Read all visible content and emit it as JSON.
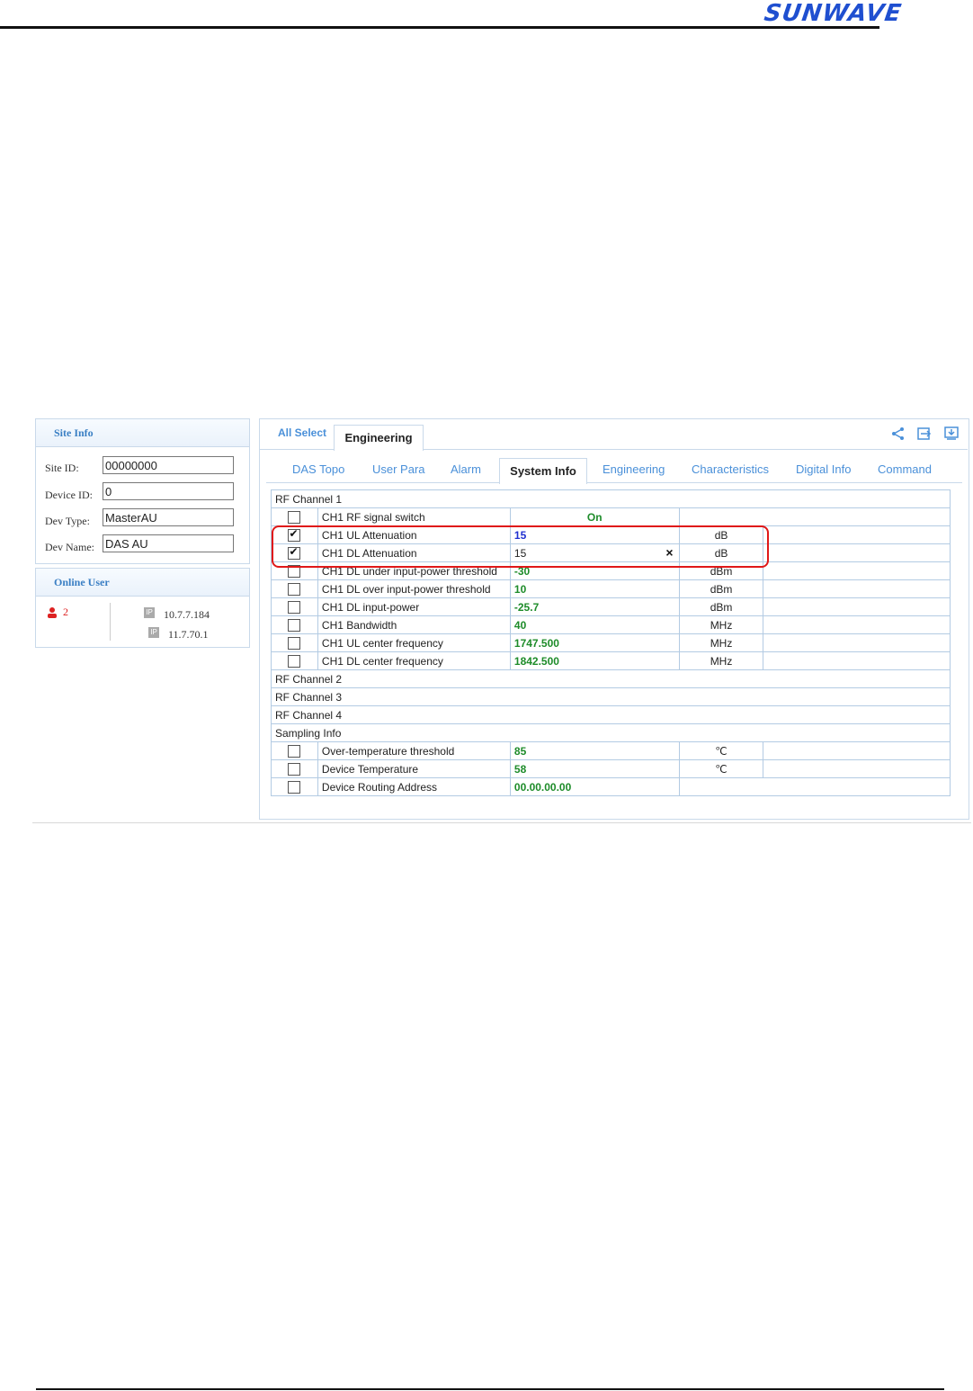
{
  "brand": {
    "logo_text": "SUNWAVE"
  },
  "site_info": {
    "title": "Site Info",
    "fields": [
      {
        "label": "Site ID:",
        "value": "00000000"
      },
      {
        "label": "Device ID:",
        "value": "0"
      },
      {
        "label": "Dev Type:",
        "value": "MasterAU"
      },
      {
        "label": "Dev Name:",
        "value": "DAS AU"
      }
    ]
  },
  "online_user": {
    "title": "Online User",
    "count": "2",
    "ips": [
      "10.7.7.184",
      "11.7.70.1"
    ],
    "ip_badge": "IP"
  },
  "top_tabs": [
    "All Select",
    "Engineering"
  ],
  "toolbar": {
    "share_icon": "share-icon",
    "export_icon": "export-icon",
    "download_icon": "download-icon"
  },
  "sub_tabs": [
    "DAS Topo",
    "User Para",
    "Alarm",
    "System Info",
    "Engineering",
    "Characteristics",
    "Digital Info",
    "Command"
  ],
  "active_sub_tab": "System Info",
  "groups": {
    "rf1": "RF Channel 1",
    "rf2": "RF Channel 2",
    "rf3": "RF Channel 3",
    "rf4": "RF Channel 4",
    "sampling": "Sampling Info"
  },
  "rf1_rows": [
    {
      "name": "CH1 RF signal switch",
      "value": "On",
      "unit": "",
      "checked": false
    },
    {
      "name": "CH1 UL Attenuation",
      "value": "15",
      "unit": "dB",
      "checked": true
    },
    {
      "name": "CH1 DL Attenuation",
      "value": "15",
      "unit": "dB",
      "checked": true,
      "clear": "×"
    },
    {
      "name": "CH1 DL under input-power threshold",
      "value": "-30",
      "unit": "dBm",
      "checked": false
    },
    {
      "name": "CH1 DL over input-power threshold",
      "value": "10",
      "unit": "dBm",
      "checked": false
    },
    {
      "name": "CH1 DL input-power",
      "value": "-25.7",
      "unit": "dBm",
      "checked": false
    },
    {
      "name": "CH1 Bandwidth",
      "value": "40",
      "unit": "MHz",
      "checked": false
    },
    {
      "name": "CH1 UL center frequency",
      "value": "1747.500",
      "unit": "MHz",
      "checked": false
    },
    {
      "name": "CH1 DL center frequency",
      "value": "1842.500",
      "unit": "MHz",
      "checked": false
    }
  ],
  "sampling_rows": [
    {
      "name": "Over-temperature threshold",
      "value": "85",
      "unit": "℃",
      "checked": false
    },
    {
      "name": "Device Temperature",
      "value": "58",
      "unit": "℃",
      "checked": false
    },
    {
      "name": "Device Routing Address",
      "value": "00.00.00.00",
      "unit": "",
      "checked": false
    }
  ],
  "colors": {
    "accent": "#4a90d9",
    "value_green": "#1e8c2a",
    "value_blue": "#2030d0",
    "highlight_red": "#e01818"
  }
}
